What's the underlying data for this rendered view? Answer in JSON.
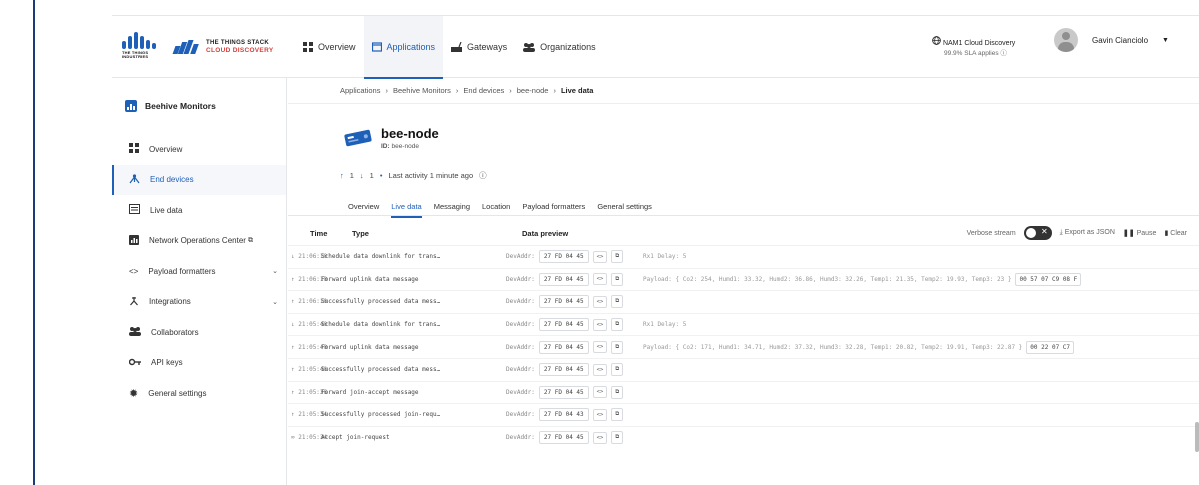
{
  "header": {
    "tti_logo_text": "THE THINGS\nINDUSTRIES",
    "stack_line1": "THE THINGS STACK",
    "stack_line2": "CLOUD DISCOVERY",
    "nav": [
      {
        "label": "Overview",
        "icon": "grid-icon"
      },
      {
        "label": "Applications",
        "icon": "window-icon"
      },
      {
        "label": "Gateways",
        "icon": "gateway-icon"
      },
      {
        "label": "Organizations",
        "icon": "people-icon"
      }
    ],
    "cluster_name": "NAM1 Cloud Discovery",
    "cluster_sla": "99.9% SLA applies",
    "user_name": "Gavin Cianciolo",
    "accent": "#1e5fb8",
    "brand_red": "#d8403b"
  },
  "sidebar": {
    "app_name": "Beehive Monitors",
    "items": [
      {
        "label": "Overview",
        "icon": "grid-icon"
      },
      {
        "label": "End devices",
        "icon": "end-device-icon"
      },
      {
        "label": "Live data",
        "icon": "list-icon"
      },
      {
        "label": "Network Operations Center",
        "icon": "chart-icon"
      },
      {
        "label": "Payload formatters",
        "icon": "code-icon"
      },
      {
        "label": "Integrations",
        "icon": "integration-icon"
      },
      {
        "label": "Collaborators",
        "icon": "people-icon"
      },
      {
        "label": "API keys",
        "icon": "key-icon"
      },
      {
        "label": "General settings",
        "icon": "gear-icon"
      }
    ]
  },
  "breadcrumb": [
    "Applications",
    "Beehive Monitors",
    "End devices",
    "bee-node",
    "Live data"
  ],
  "device": {
    "name": "bee-node",
    "id_label": "ID:",
    "id": "bee-node",
    "uplinks": "1",
    "downlinks": "1",
    "last_activity": "Last activity 1 minute ago"
  },
  "tabs": [
    "Overview",
    "Live data",
    "Messaging",
    "Location",
    "Payload formatters",
    "General settings"
  ],
  "table": {
    "col_time": "Time",
    "col_type": "Type",
    "col_preview": "Data preview",
    "verbose_label": "Verbose stream",
    "export_label": "Export as JSON",
    "pause_label": "Pause",
    "clear_label": "Clear",
    "rows": [
      {
        "dir": "↓",
        "time": "21:06:10",
        "type": "Schedule data downlink for trans…",
        "addr_label": "DevAddr:",
        "addr": "27 FD 04 45",
        "extra": "Rx1 Delay: 5",
        "raw": ""
      },
      {
        "dir": "↑",
        "time": "21:06:10",
        "type": "Forward uplink data message",
        "addr_label": "DevAddr:",
        "addr": "27 FD 04 45",
        "extra": "Payload: { Co2: 254, Humd1: 33.32, Humd2: 36.86, Humd3: 32.26, Temp1: 21.35, Temp2: 19.93, Temp3: 23 }",
        "raw": "00 57 07 C9 08 F"
      },
      {
        "dir": "↑",
        "time": "21:06:10",
        "type": "Successfully processed data mess…",
        "addr_label": "DevAddr:",
        "addr": "27 FD 04 45",
        "extra": "",
        "raw": ""
      },
      {
        "dir": "↓",
        "time": "21:05:40",
        "type": "Schedule data downlink for trans…",
        "addr_label": "DevAddr:",
        "addr": "27 FD 04 45",
        "extra": "Rx1 Delay: 5",
        "raw": ""
      },
      {
        "dir": "↑",
        "time": "21:05:40",
        "type": "Forward uplink data message",
        "addr_label": "DevAddr:",
        "addr": "27 FD 04 45",
        "extra": "Payload: { Co2: 171, Humd1: 34.71, Humd2: 37.32, Humd3: 32.28, Temp1: 20.82, Temp2: 19.91, Temp3: 22.87 }",
        "raw": "00 22 07 C7"
      },
      {
        "dir": "↑",
        "time": "21:05:40",
        "type": "Successfully processed data mess…",
        "addr_label": "DevAddr:",
        "addr": "27 FD 04 45",
        "extra": "",
        "raw": ""
      },
      {
        "dir": "↑",
        "time": "21:05:36",
        "type": "Forward join-accept message",
        "addr_label": "DevAddr:",
        "addr": "27 FD 04 45",
        "extra": "",
        "raw": ""
      },
      {
        "dir": "↑",
        "time": "21:05:34",
        "type": "Successfully processed join-requ…",
        "addr_label": "DevAddr:",
        "addr": "27 FD 04 43",
        "extra": "",
        "raw": ""
      },
      {
        "dir": "∞",
        "time": "21:05:34",
        "type": "Accept join-request",
        "addr_label": "DevAddr:",
        "addr": "27 FD 04 45",
        "extra": "",
        "raw": ""
      }
    ]
  }
}
